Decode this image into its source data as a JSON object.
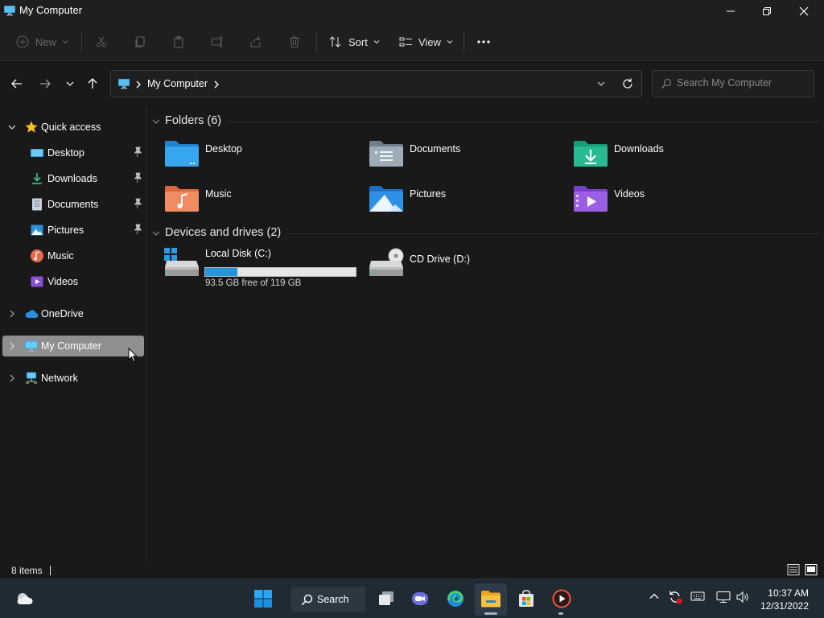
{
  "window": {
    "title": "My Computer"
  },
  "toolbar": {
    "new_label": "New",
    "sort_label": "Sort",
    "view_label": "View"
  },
  "address": {
    "location": "My Computer"
  },
  "search": {
    "placeholder": "Search My Computer"
  },
  "sidebar": {
    "items": [
      {
        "label": "Quick access",
        "icon": "star-icon"
      },
      {
        "label": "Desktop",
        "icon": "desktop-icon",
        "pinned": true
      },
      {
        "label": "Downloads",
        "icon": "download-icon",
        "pinned": true
      },
      {
        "label": "Documents",
        "icon": "document-icon",
        "pinned": true
      },
      {
        "label": "Pictures",
        "icon": "picture-icon",
        "pinned": true
      },
      {
        "label": "Music",
        "icon": "music-icon"
      },
      {
        "label": "Videos",
        "icon": "video-icon"
      },
      {
        "label": "OneDrive",
        "icon": "cloud-icon"
      },
      {
        "label": "My Computer",
        "icon": "computer-icon",
        "selected": true
      },
      {
        "label": "Network",
        "icon": "network-icon"
      }
    ]
  },
  "folders": {
    "header": "Folders (6)",
    "items": [
      {
        "label": "Desktop",
        "icon": "desktop-folder-icon"
      },
      {
        "label": "Documents",
        "icon": "documents-folder-icon"
      },
      {
        "label": "Downloads",
        "icon": "downloads-folder-icon"
      },
      {
        "label": "Music",
        "icon": "music-folder-icon"
      },
      {
        "label": "Pictures",
        "icon": "pictures-folder-icon"
      },
      {
        "label": "Videos",
        "icon": "videos-folder-icon"
      }
    ]
  },
  "drives": {
    "header": "Devices and drives (2)",
    "items": [
      {
        "label": "Local Disk (C:)",
        "free_text": "93.5 GB free of 119 GB",
        "used_fraction": 0.214,
        "icon": "hard-drive-icon"
      },
      {
        "label": "CD Drive (D:)",
        "icon": "cd-drive-icon"
      }
    ]
  },
  "status": {
    "items_count": "8 items"
  },
  "taskbar": {
    "search_label": "Search",
    "time": "10:37 AM",
    "date": "12/31/2022"
  },
  "colors": {
    "accent": "#2696dc",
    "selected_bg": "#8f8f8f",
    "window_bg": "#191919",
    "taskbar_bg": "#202a33"
  }
}
